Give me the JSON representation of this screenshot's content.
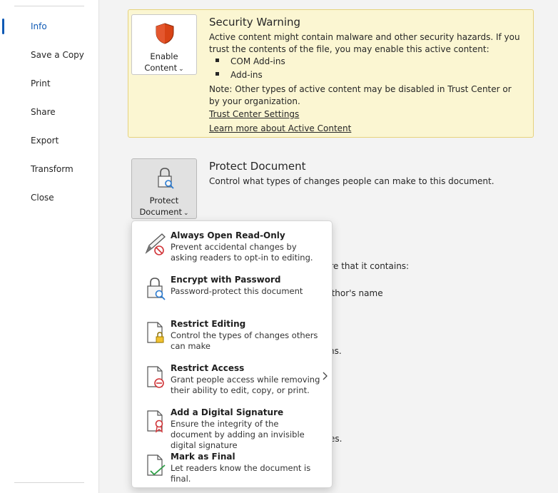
{
  "sidebar": {
    "items": [
      {
        "label": "Info",
        "active": true
      },
      {
        "label": "Save a Copy"
      },
      {
        "label": "Print"
      },
      {
        "label": "Share"
      },
      {
        "label": "Export"
      },
      {
        "label": "Transform"
      },
      {
        "label": "Close"
      }
    ]
  },
  "security": {
    "button_line1": "Enable",
    "button_line2": "Content",
    "title": "Security Warning",
    "text": "Active content might contain malware and other security hazards. If you trust the contents of the file, you may enable this active content:",
    "bullets": [
      "COM Add-ins",
      "Add-ins"
    ],
    "note": "Note: Other types of active content may be disabled in Trust Center or by your organization.",
    "link_trust": "Trust Center Settings",
    "link_learn": "Learn more about Active Content"
  },
  "protect": {
    "button_line1": "Protect",
    "button_line2": "Document",
    "title": "Protect Document",
    "text": "Control what types of changes people can make to this document."
  },
  "background_fragments": [
    "are that it contains:",
    "uthor's name",
    "ns.",
    "es."
  ],
  "menu": {
    "items": [
      {
        "title": "Always Open Read-Only",
        "desc": "Prevent accidental changes by asking readers to opt-in to editing.",
        "icon": "pencil-no-icon"
      },
      {
        "title": "Encrypt with Password",
        "desc": "Password-protect this document",
        "icon": "lock-key-icon"
      },
      {
        "title": "Restrict Editing",
        "desc": "Control the types of changes others can make",
        "icon": "doc-lock-icon"
      },
      {
        "title": "Restrict Access",
        "desc": "Grant people access while removing their ability to edit, copy, or print.",
        "icon": "doc-restrict-icon"
      },
      {
        "title": "Add a Digital Signature",
        "desc": "Ensure the integrity of the document by adding an invisible digital signature",
        "icon": "doc-ribbon-icon"
      },
      {
        "title": "Mark as Final",
        "desc": "Let readers know the document is final.",
        "icon": "doc-check-icon"
      }
    ]
  },
  "colors": {
    "accent": "#0f5ab5",
    "warning_bg": "#fbf6d2",
    "shield": "#d84315"
  }
}
